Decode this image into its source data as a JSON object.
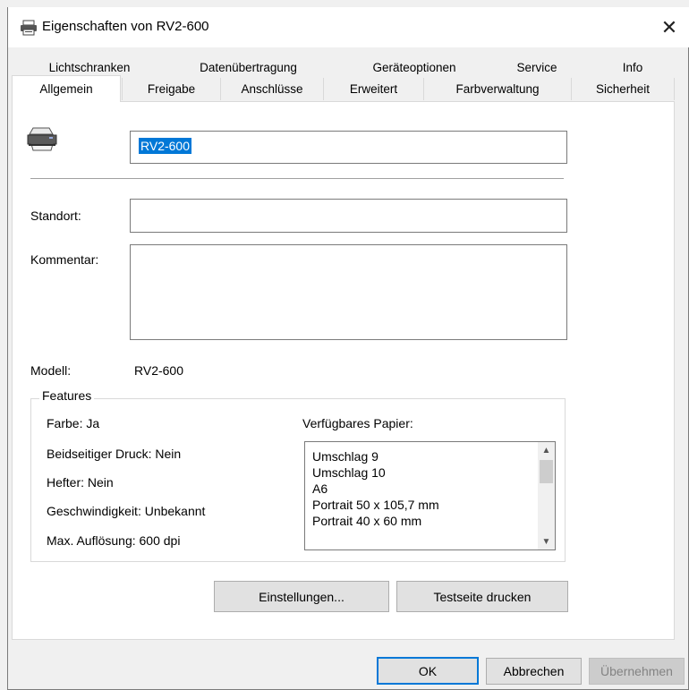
{
  "window": {
    "title": "Eigenschaften von RV2-600",
    "close_glyph": "✕"
  },
  "tabs": {
    "back_row": [
      "Lichtschranken",
      "Datenübertragung",
      "Geräteoptionen",
      "Service",
      "Info"
    ],
    "front_row": [
      "Allgemein",
      "Freigabe",
      "Anschlüsse",
      "Erweitert",
      "Farbverwaltung",
      "Sicherheit"
    ],
    "active": "Allgemein"
  },
  "general": {
    "printer_name": "RV2-600",
    "location_label": "Standort:",
    "location_value": "",
    "comment_label": "Kommentar:",
    "comment_value": "",
    "model_label": "Modell:",
    "model_value": "RV2-600"
  },
  "features": {
    "legend": "Features",
    "color": "Farbe: Ja",
    "duplex": "Beidseitiger Druck: Nein",
    "staple": "Hefter: Nein",
    "speed": "Geschwindigkeit: Unbekannt",
    "resolution": "Max. Auflösung: 600 dpi",
    "paper_label": "Verfügbares Papier:",
    "paper_list": [
      "Umschlag 9",
      "Umschlag 10",
      "A6",
      "Portrait 50 x 105,7 mm",
      "Portrait 40 x 60 mm"
    ]
  },
  "buttons": {
    "settings": "Einstellungen...",
    "test_page": "Testseite drucken",
    "ok": "OK",
    "cancel": "Abbrechen",
    "apply": "Übernehmen"
  },
  "icons": {
    "title": "printer-icon",
    "printer": "printer-icon",
    "scroll_up": "▲",
    "scroll_down": "▼"
  },
  "colors": {
    "accent": "#0078d7",
    "panel": "#ffffff",
    "chrome": "#f0f0f0"
  }
}
